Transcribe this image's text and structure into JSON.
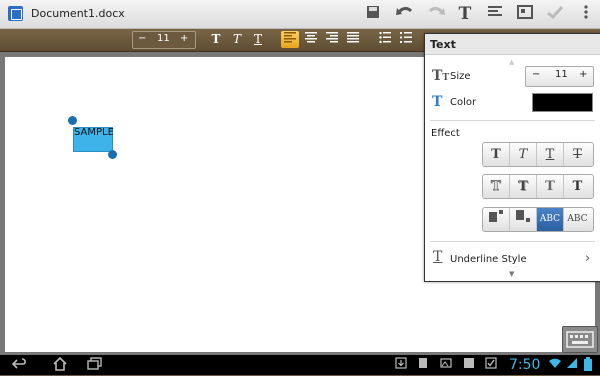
{
  "window": {
    "doc_title": "Document1.docx"
  },
  "toolbar": {
    "icons": [
      "save-icon",
      "undo-icon",
      "redo-icon",
      "text-format-icon",
      "paragraph-icon",
      "insert-image-icon",
      "pen-icon",
      "overflow-menu-icon"
    ]
  },
  "format_bar": {
    "font_size_minus": "−",
    "font_size_value": "11",
    "font_size_plus": "+",
    "bold_label": "T",
    "italic_label": "T",
    "underline_label": "T"
  },
  "document": {
    "sample_text": "SAMPLE"
  },
  "text_panel": {
    "title": "Text",
    "size_label": "Size",
    "size_value": "11",
    "size_minus": "−",
    "size_plus": "+",
    "color_label": "Color",
    "color_value": "#000000",
    "effect_label": "Effect",
    "effect_row1": [
      "T",
      "T",
      "T",
      "T"
    ],
    "effect_row2": [
      "T",
      "T",
      "T",
      "T"
    ],
    "effect_row3": [
      "",
      "",
      "ABC",
      "ABC"
    ],
    "underline_label": "Underline Style"
  },
  "navbar": {
    "clock": "7:50"
  }
}
